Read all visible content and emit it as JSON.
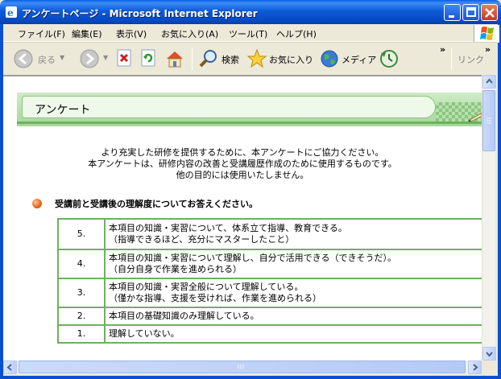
{
  "window": {
    "title": "アンケートページ - Microsoft Internet Explorer"
  },
  "menu": {
    "items": [
      "ファイル(F)",
      "編集(E)",
      "表示(V)",
      "お気に入り(A)",
      "ツール(T)",
      "ヘルプ(H)"
    ]
  },
  "toolbar": {
    "back_label": "戻る",
    "search_label": "検索",
    "favorites_label": "お気に入り",
    "media_label": "メディア",
    "chevron": "»",
    "links_label": "リンク"
  },
  "page": {
    "banner_title": "アンケート",
    "intro": [
      "より充実した研修を提供するために、本アンケートにご協力ください。",
      "本アンケートは、研修内容の改善と受講履歴作成のために使用するものです。",
      "他の目的には使用いたしません。"
    ],
    "section_title": "受講前と受講後の理解度についてお答えください。",
    "scale": [
      {
        "num": "5.",
        "lines": [
          "本項目の知識・実習について、体系立て指導、教育できる。",
          "（指導できるほど、充分にマスターしたこと）"
        ]
      },
      {
        "num": "4.",
        "lines": [
          "本項目の知識・実習について理解し、自分で活用できる（できそうだ）。",
          "（自分自身で作業を進められる）"
        ]
      },
      {
        "num": "3.",
        "lines": [
          "本項目の知識・実習全般について理解している。",
          "（僅かな指導、支援を受ければ、作業を進められる）"
        ]
      },
      {
        "num": "2.",
        "lines": [
          "本項目の基礎知識のみ理解している。"
        ]
      },
      {
        "num": "1.",
        "lines": [
          "理解していない。"
        ]
      }
    ]
  },
  "colors": {
    "accent_green": "#6CB25D",
    "titlebar_blue": "#0649C3",
    "bullet_orange": "#E0661C"
  }
}
